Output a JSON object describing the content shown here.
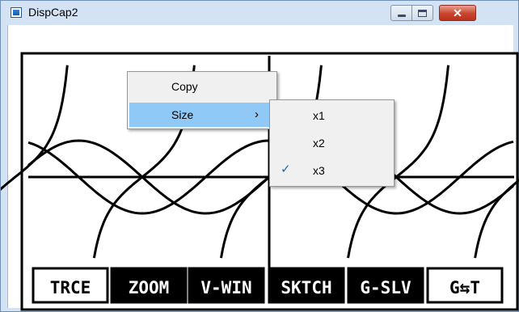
{
  "window": {
    "title": "DispCap2",
    "close_glyph": "✕",
    "icon": "app-window-icon"
  },
  "calculator": {
    "function_keys": [
      "TRCE",
      "ZOOM",
      "V-WIN",
      "SKTCH",
      "G-SLV",
      "G⇆T"
    ],
    "highlighted_keys": [
      false,
      true,
      true,
      true,
      true,
      false
    ]
  },
  "context_menu": {
    "items": [
      {
        "label": "Copy",
        "highlighted": false
      },
      {
        "label": "Size",
        "highlighted": true,
        "has_submenu": true,
        "arrow": "›"
      }
    ]
  },
  "size_submenu": {
    "items": [
      {
        "label": "x1",
        "checked": false
      },
      {
        "label": "x2",
        "checked": false
      },
      {
        "label": "x3",
        "checked": true
      }
    ],
    "check_glyph": "✓"
  },
  "colors": {
    "menu_highlight": "#90c8f6",
    "menu_background": "#f0f0f0",
    "close_button": "#c9432d",
    "title_bar": "#d4e3f4"
  }
}
